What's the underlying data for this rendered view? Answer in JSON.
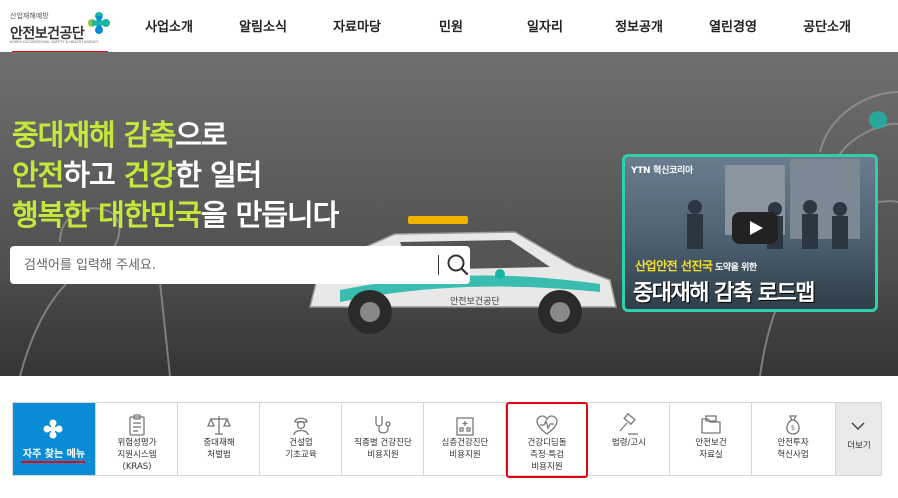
{
  "logo": {
    "small_text": "산업재해예방",
    "name": "안전보건공단",
    "english": "KOREA OCCUPATIONAL SAFETY & HEALTH AGENCY"
  },
  "nav": {
    "items": [
      "사업소개",
      "알림소식",
      "자료마당",
      "민원",
      "일자리",
      "정보공개",
      "열린경영",
      "공단소개"
    ]
  },
  "hero": {
    "line1_hl": "중대재해 감축",
    "line1_rest": "으로",
    "line2_hl1": "안전",
    "line2_mid": "하고 ",
    "line2_hl2": "건강",
    "line2_rest": "한 일터",
    "line3_hl": "행복한 대한민국",
    "line3_rest": "을 만듭니다",
    "car_text": "안전보건공단"
  },
  "search": {
    "placeholder": "검색어를 입력해 주세요."
  },
  "video": {
    "tag": "YTN 혁신코리아",
    "sub_a": "산업안전 선진국",
    "sub_b": " 도약을 위한",
    "title": "중대재해 감축 로드맵"
  },
  "quick_menu": {
    "head_label": "자주 찾는 메뉴",
    "items": [
      {
        "label": "위험성평가\n지원시스템\n(KRAS)",
        "icon": "clipboard-icon"
      },
      {
        "label": "중대재해\n처벌법",
        "icon": "scales-icon"
      },
      {
        "label": "건설업\n기초교육",
        "icon": "worker-icon"
      },
      {
        "label": "직종별 건강진단\n비용지원",
        "icon": "stethoscope-icon"
      },
      {
        "label": "심층건강진단\n비용지원",
        "icon": "hospital-icon"
      },
      {
        "label": "건강디딤돌\n측정·특검\n비용지원",
        "icon": "heartbeat-icon"
      },
      {
        "label": "법령/고시",
        "icon": "gavel-icon"
      },
      {
        "label": "안전보건\n자료실",
        "icon": "folder-icon"
      },
      {
        "label": "안전투자\n혁신사업",
        "icon": "money-bag-icon"
      }
    ],
    "more_label": "더보기"
  },
  "colors": {
    "accent_red": "#e30613",
    "quick_blue": "#0a8bd6",
    "hero_highlight": "#c6e83c",
    "video_border": "#2fcfaa"
  }
}
